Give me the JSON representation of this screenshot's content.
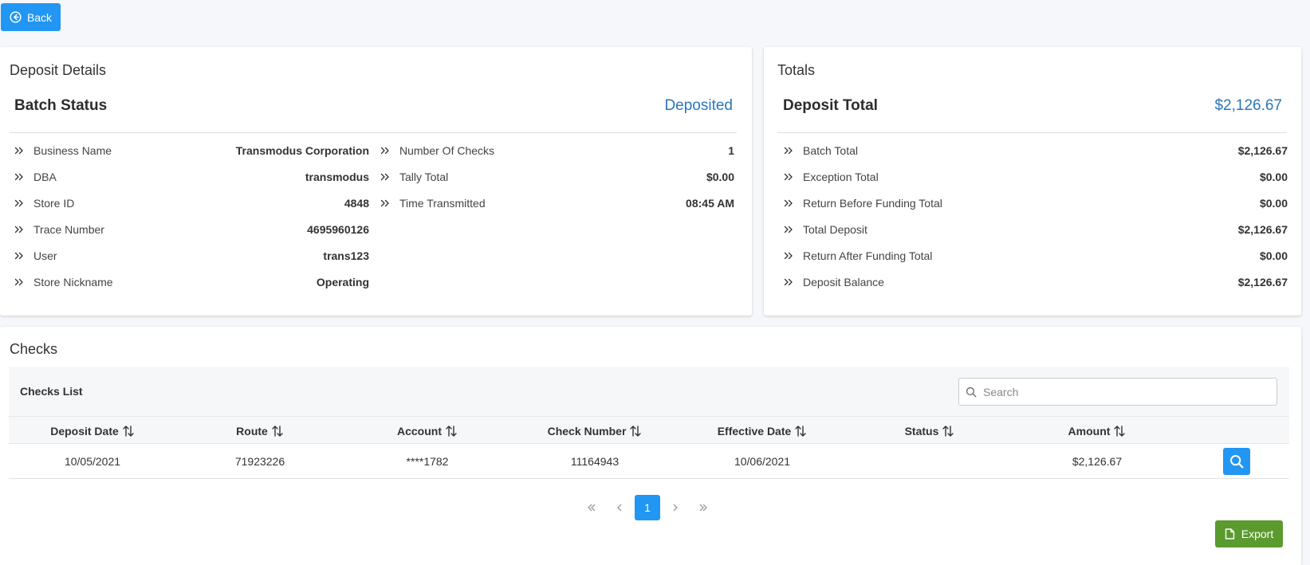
{
  "back_label": "Back",
  "deposit_details": {
    "title": "Deposit Details",
    "status_label": "Batch Status",
    "status_value": "Deposited",
    "left_rows": [
      {
        "label": "Business Name",
        "value": "Transmodus Corporation"
      },
      {
        "label": "DBA",
        "value": "transmodus"
      },
      {
        "label": "Store ID",
        "value": "4848"
      },
      {
        "label": "Trace Number",
        "value": "4695960126"
      },
      {
        "label": "User",
        "value": "trans123"
      },
      {
        "label": "Store Nickname",
        "value": "Operating"
      }
    ],
    "right_rows": [
      {
        "label": "Number Of Checks",
        "value": "1"
      },
      {
        "label": "Tally Total",
        "value": "$0.00"
      },
      {
        "label": "Time Transmitted",
        "value": "08:45 AM"
      }
    ]
  },
  "totals": {
    "title": "Totals",
    "header_label": "Deposit Total",
    "header_value": "$2,126.67",
    "rows": [
      {
        "label": "Batch Total",
        "value": "$2,126.67"
      },
      {
        "label": "Exception Total",
        "value": "$0.00"
      },
      {
        "label": "Return Before Funding Total",
        "value": "$0.00"
      },
      {
        "label": "Total Deposit",
        "value": "$2,126.67"
      },
      {
        "label": "Return After Funding Total",
        "value": "$0.00"
      },
      {
        "label": "Deposit Balance",
        "value": "$2,126.67"
      }
    ]
  },
  "checks": {
    "title": "Checks",
    "list_title": "Checks List",
    "search_placeholder": "Search",
    "columns": [
      "Deposit Date",
      "Route",
      "Account",
      "Check Number",
      "Effective Date",
      "Status",
      "Amount"
    ],
    "rows": [
      {
        "deposit_date": "10/05/2021",
        "route": "71923226",
        "account": "****1782",
        "check_number": "11164943",
        "effective_date": "10/06/2021",
        "status": "",
        "amount": "$2,126.67"
      }
    ],
    "pagination": {
      "current_page": "1"
    },
    "export_label": "Export"
  },
  "colors": {
    "primary": "#2196f3",
    "accent_text": "#2b76bc",
    "export": "#5a9a2f",
    "background": "#f5f7fa"
  }
}
